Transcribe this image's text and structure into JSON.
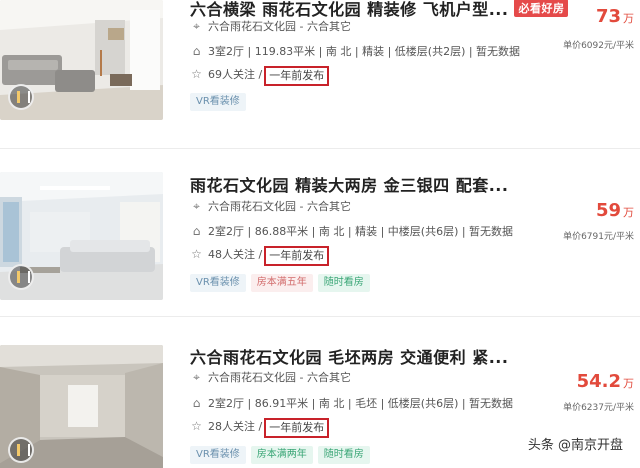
{
  "listings": [
    {
      "title": "六合横梁 雨花石文化园 精装修 飞机户型...",
      "badge": "必看好房",
      "location": "六合雨花石文化园 - 六合其它",
      "attributes": "3室2厅 | 119.83平米 | 南 北 | 精装 | 低楼层(共2层) | 暂无数据",
      "follow": "69人关注",
      "published": "一年前发布",
      "tags": [
        "VR看装修"
      ],
      "price": "73",
      "price_unit": "万",
      "unit_price": "单价6092元/平米"
    },
    {
      "title": "雨花石文化园 精装大两房 金三银四 配套...",
      "location": "六合雨花石文化园 - 六合其它",
      "attributes": "2室2厅 | 86.88平米 | 南 北 | 精装 | 中楼层(共6层) | 暂无数据",
      "follow": "48人关注",
      "published": "一年前发布",
      "tags": [
        "VR看装修",
        "房本满五年",
        "随时看房"
      ],
      "price": "59",
      "price_unit": "万",
      "unit_price": "单价6791元/平米"
    },
    {
      "title": "六合雨花石文化园 毛坯两房 交通便利 紧...",
      "location": "六合雨花石文化园 - 六合其它",
      "attributes": "2室2厅 | 86.91平米 | 南 北 | 毛坯 | 低楼层(共6层) | 暂无数据",
      "follow": "28人关注",
      "published": "一年前发布",
      "tags": [
        "VR看装修",
        "房本满两年",
        "随时看房"
      ],
      "price": "54.2",
      "price_unit": "万",
      "unit_price": "单价6237元/平米"
    }
  ],
  "follow_separator": "/",
  "watermark": "头条 @南京开盘",
  "colors": {
    "price": "#e24a3c",
    "highlight_border": "#c8222a",
    "badge": "#e54a4a"
  },
  "icons": {
    "location": "location-pin-icon",
    "attributes": "house-icon",
    "follow": "star-icon",
    "vr": "vr-icon"
  }
}
